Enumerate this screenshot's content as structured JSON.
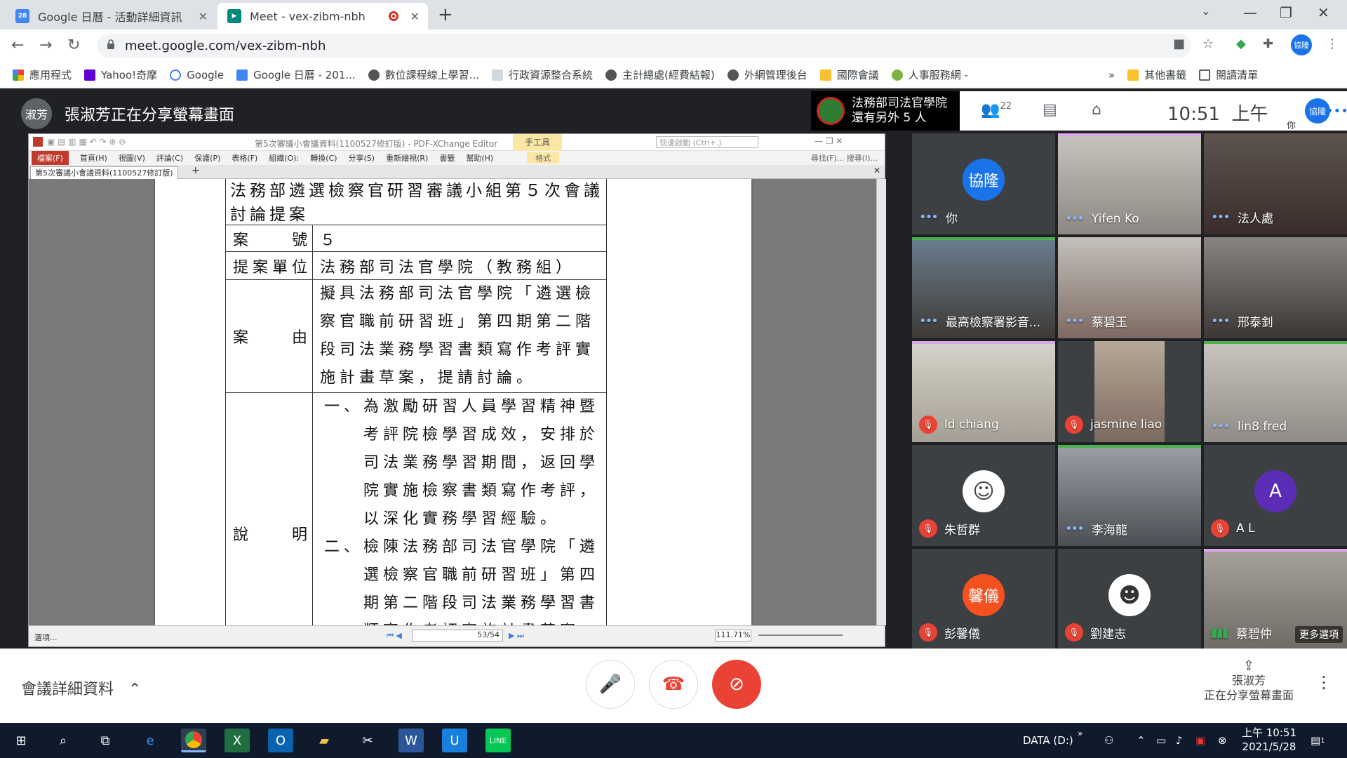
{
  "browser": {
    "tabs": [
      {
        "title": "Google 日曆 - 活動詳細資訊",
        "favicon": "calendar-icon"
      },
      {
        "title": "Meet - vex-zibm-nbh",
        "favicon": "meet-icon"
      }
    ],
    "url": "meet.google.com/vex-zibm-nbh",
    "profile_initials": "協隆",
    "bookmarks": [
      "應用程式",
      "Yahoo!奇摩",
      "Google",
      "Google 日曆 - 201...",
      "數位課程線上學習...",
      "行政資源整合系統",
      "主計總處(經費結報)",
      "外網管理後台",
      "國際會議",
      "人事服務網 -",
      "其他書籤",
      "閱讀清單"
    ],
    "bookmarks_more": "»"
  },
  "meet": {
    "presenter_banner": "張淑芳正在分享螢幕畫面",
    "presenter_initials": "淑芳",
    "top_info": {
      "line1": "法務部司法官學院",
      "line2": "還有另外 5 人"
    },
    "participant_count": "22",
    "time": "10:51",
    "ampm": "上午",
    "you_initials": "協隆",
    "you_label": "你",
    "participants": [
      {
        "name": "你",
        "initials": "協隆",
        "muted": false,
        "avatar_color": "#1a73e8"
      },
      {
        "name": "Yifen Ko",
        "muted": false
      },
      {
        "name": "法人處",
        "muted": false
      },
      {
        "name": "最高檢察署影音...",
        "muted": false
      },
      {
        "name": "蔡碧玉",
        "muted": false
      },
      {
        "name": "邢泰釗",
        "muted": false
      },
      {
        "name": "ld chiang",
        "muted": true
      },
      {
        "name": "jasmine liao",
        "muted": true
      },
      {
        "name": "lin8 fred",
        "muted": false
      },
      {
        "name": "朱哲群",
        "muted": true
      },
      {
        "name": "李海龍",
        "muted": false
      },
      {
        "name": "A L",
        "initials": "A",
        "muted": true,
        "avatar_color": "#5b2db6"
      },
      {
        "name": "彭馨儀",
        "initials": "馨儀",
        "muted": true,
        "avatar_color": "#f4511e"
      },
      {
        "name": "劉建志",
        "muted": true
      },
      {
        "name": "蔡碧仲",
        "muted": false
      }
    ],
    "more_options": "更多選項",
    "meeting_details": "會議詳細資料",
    "presenting": {
      "name": "張淑芳",
      "status": "正在分享螢幕畫面"
    }
  },
  "pdf": {
    "window_title": "第5次審議小會議資料(1100527修訂版) - PDF-XChange Editor",
    "tool_tab": "手工具",
    "tool_sub": "格式",
    "search_placeholder": "快速啟動 (Ctrl+.)",
    "menus": [
      "檔案(F)",
      "首頁(H)",
      "視圖(V)",
      "評論(C)",
      "保護(P)",
      "表格(F)",
      "組織(O):",
      "轉換(C)",
      "分享(S)",
      "重新繪視(R)",
      "書籤",
      "幫助(H)"
    ],
    "menu_right": "尋找(F)...  搜尋(I)...",
    "doc_tab": "第5次審議小會議資料(1100527修訂版)",
    "status_left": "選項...",
    "page_indicator": "53/54",
    "zoom": "111.71%",
    "doc": {
      "heading": "法務部遴選檢察官研習審議小組第５次會議討論提案",
      "case_no_label": "案　　號",
      "case_no": "５",
      "unit_label": "提案單位",
      "unit": "法務部司法官學院（教務組）",
      "reason_label": "案　　由",
      "reason": "擬具法務部司法官學院「遴選檢察官職前研習班」第四期第二階段司法業務學習書類寫作考評實施計畫草案，提請討論。",
      "desc_label": "說　　明",
      "desc_items": [
        "一、為激勵研習人員學習精神暨考評院檢學習成效，安排於司法業務學習期間，返回學院實施檢察書類寫作考評，以深化實務學習經驗。",
        "二、檢陳法務部司法官學院「遴選檢察官職前研習班」第四期第二階段司法業務學習書類寫作考評實施計畫草案，如後附。"
      ]
    }
  },
  "taskbar": {
    "drive": "DATA (D:)",
    "time": "上午 10:51",
    "date": "2021/5/28",
    "notif_count": "1"
  }
}
